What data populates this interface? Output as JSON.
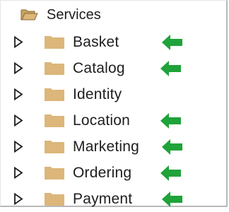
{
  "tree": {
    "root": {
      "label": "Services",
      "icon": "open-folder-icon"
    },
    "items": [
      {
        "label": "Basket",
        "icon": "folder-icon",
        "marked": true
      },
      {
        "label": "Catalog",
        "icon": "folder-icon",
        "marked": true
      },
      {
        "label": "Identity",
        "icon": "folder-icon",
        "marked": false
      },
      {
        "label": "Location",
        "icon": "folder-icon",
        "marked": true
      },
      {
        "label": "Marketing",
        "icon": "folder-icon",
        "marked": true
      },
      {
        "label": "Ordering",
        "icon": "folder-icon",
        "marked": true
      },
      {
        "label": "Payment",
        "icon": "folder-icon",
        "marked": true
      }
    ],
    "expander_icon": "triangle-right-icon",
    "marker_icon": "arrow-left-icon"
  },
  "colors": {
    "folder": "#dcb67a",
    "folder_dark": "#c9a060",
    "marker": "#1fa33a",
    "expander": "#1e1e1e",
    "text": "#1e1e1e"
  }
}
